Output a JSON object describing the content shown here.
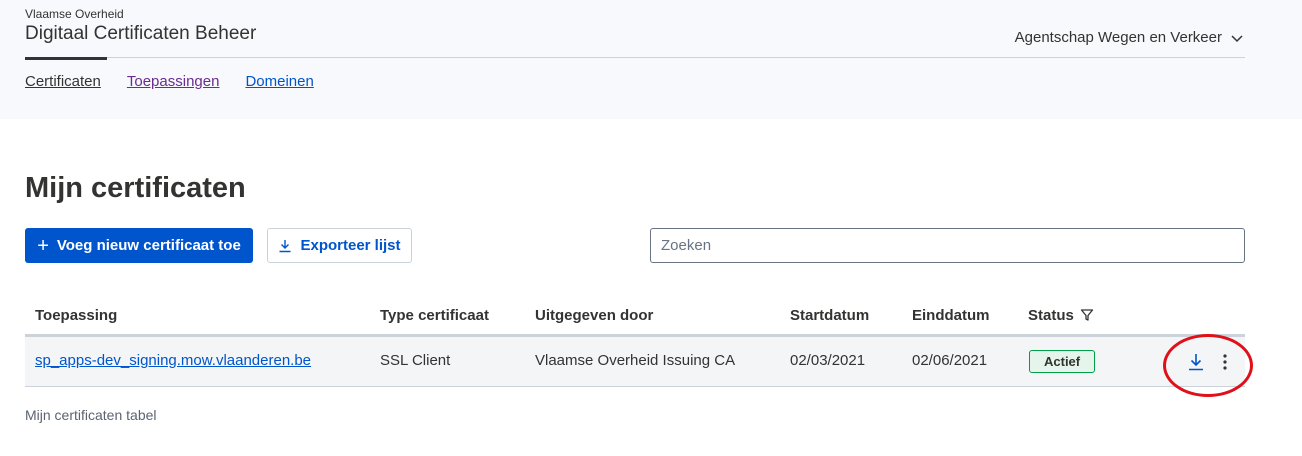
{
  "header": {
    "organization": "Vlaamse Overheid",
    "app_title": "Digitaal Certificaten Beheer",
    "agency_label": "Agentschap Wegen en Verkeer",
    "agency_icon": "chevron-down-icon"
  },
  "nav": {
    "items": [
      {
        "label": "Certificaten",
        "state": "current"
      },
      {
        "label": "Toepassingen",
        "state": "visited"
      },
      {
        "label": "Domeinen",
        "state": "link"
      }
    ]
  },
  "main": {
    "title": "Mijn certificaten",
    "add_button_label": "Voeg nieuw certificaat toe",
    "add_button_icon": "plus-icon",
    "export_button_label": "Exporteer lijst",
    "export_button_icon": "download-icon",
    "search_placeholder": "Zoeken",
    "search_value": ""
  },
  "table": {
    "columns": [
      "Toepassing",
      "Type certificaat",
      "Uitgegeven door",
      "Startdatum",
      "Einddatum",
      "Status"
    ],
    "status_filter_icon": "filter-icon",
    "rows": [
      {
        "toepassing": "sp_apps-dev_signing.mow.vlaanderen.be",
        "type": "SSL Client",
        "uitgegeven_door": "Vlaamse Overheid Issuing CA",
        "startdatum": "02/03/2021",
        "einddatum": "02/06/2021",
        "status": "Actief",
        "actions": [
          "download-icon",
          "more-vertical-icon"
        ]
      }
    ],
    "caption": "Mijn certificaten tabel"
  },
  "colors": {
    "primary": "#0055cc",
    "visited": "#6a2c91",
    "status_active_border": "#009e47",
    "annotation_circle": "#e0101a",
    "header_bg": "#f7f9fc"
  }
}
